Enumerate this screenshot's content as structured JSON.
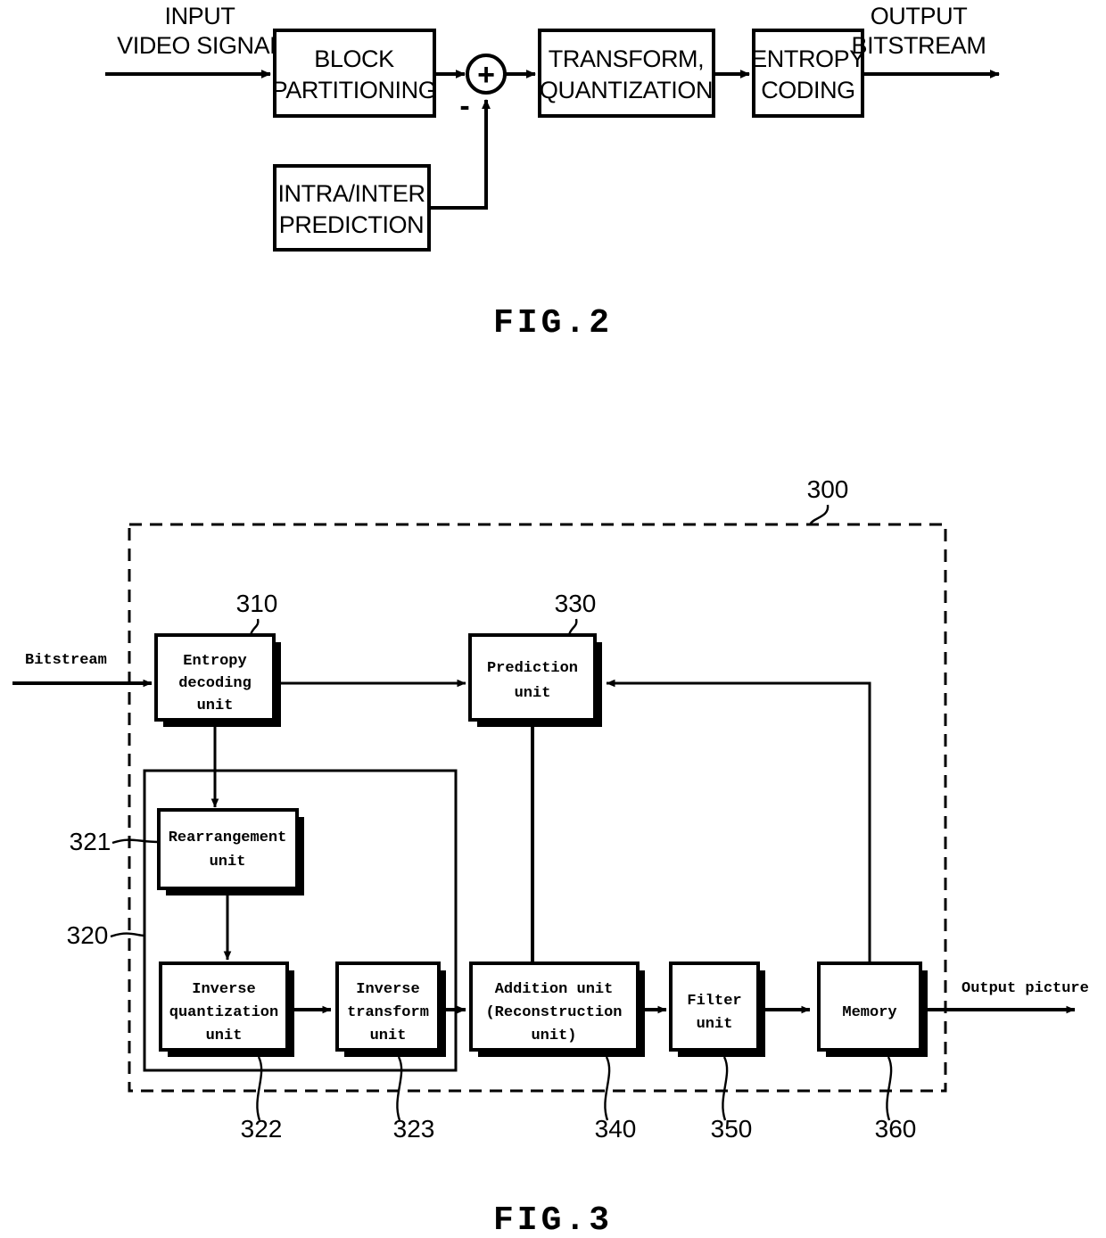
{
  "sheet": {
    "background": "#ffffff",
    "ink": "#000000"
  },
  "fig2": {
    "caption": "FIG.2",
    "input_label_line1": "INPUT",
    "input_label_line2": "VIDEO SIGNAL",
    "output_label_line1": "OUTPUT",
    "output_label_line2": "BITSTREAM",
    "sum_symbol": "+",
    "minus_symbol": "-",
    "blocks": [
      {
        "id": "block-partitioning",
        "line1": "BLOCK",
        "line2": "PARTITIONING"
      },
      {
        "id": "transform-quantization",
        "line1": "TRANSFORM,",
        "line2": "QUANTIZATION"
      },
      {
        "id": "entropy-coding",
        "line1": "ENTROPY",
        "line2": "CODING"
      },
      {
        "id": "intra-inter-prediction",
        "line1": "INTRA/INTER",
        "line2": "PREDICTION"
      }
    ]
  },
  "fig3": {
    "caption": "FIG.3",
    "input_label": "Bitstream",
    "output_label": "Output picture",
    "decoder_ref": "300",
    "blocks": [
      {
        "id": "entropy-decoding-unit",
        "ref": "310",
        "lines": [
          "Entropy",
          "decoding",
          "unit"
        ]
      },
      {
        "id": "prediction-unit",
        "ref": "330",
        "lines": [
          "Prediction",
          "unit"
        ]
      },
      {
        "id": "rearrangement-unit",
        "ref": "321",
        "lines": [
          "Rearrangement",
          "unit"
        ]
      },
      {
        "id": "inverse-quantization-unit",
        "ref": "322",
        "lines": [
          "Inverse",
          "quantization",
          "unit"
        ]
      },
      {
        "id": "inverse-transform-unit",
        "ref": "323",
        "lines": [
          "Inverse",
          "transform",
          "unit"
        ]
      },
      {
        "id": "addition-unit",
        "ref": "340",
        "lines": [
          "Addition unit",
          "(Reconstruction",
          "unit)"
        ]
      },
      {
        "id": "filter-unit",
        "ref": "350",
        "lines": [
          "Filter",
          "unit"
        ]
      },
      {
        "id": "memory",
        "ref": "360",
        "lines": [
          "Memory"
        ]
      }
    ],
    "residual_group_ref": "320"
  }
}
